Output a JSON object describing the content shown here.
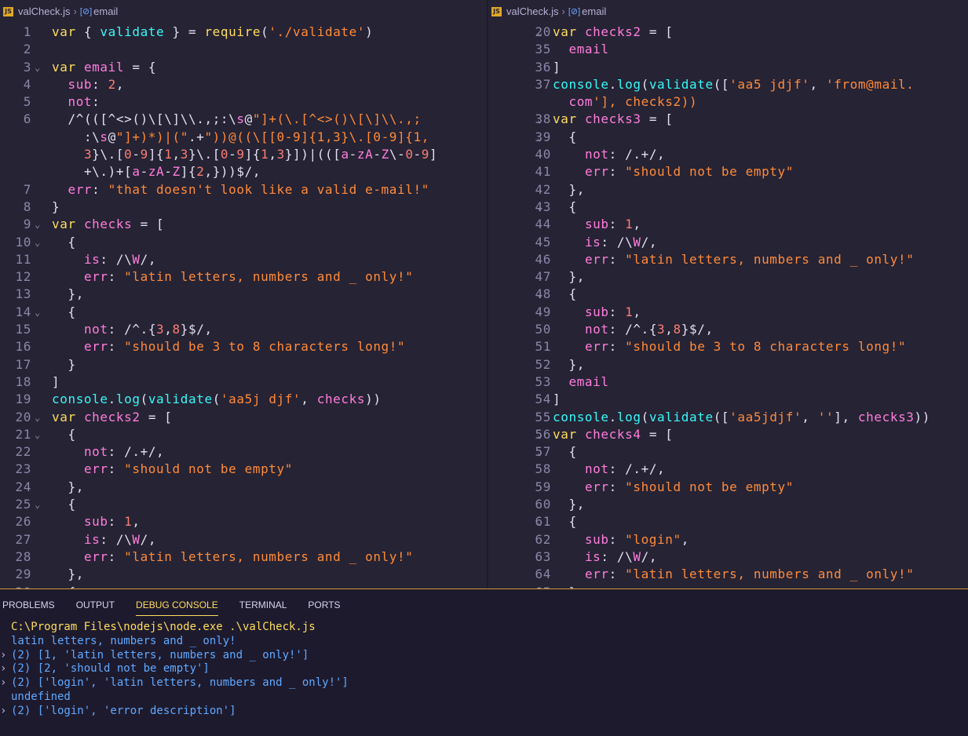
{
  "left_editor": {
    "breadcrumb": {
      "file": "valCheck.js",
      "symbol": "email"
    },
    "lines": [
      {
        "no": "1",
        "fold": "",
        "text": "var { validate } = require('./validate')"
      },
      {
        "no": "2",
        "fold": "",
        "text": ""
      },
      {
        "no": "3",
        "fold": "⌄",
        "text": "var email = {"
      },
      {
        "no": "4",
        "fold": "",
        "text": "  sub: 2,"
      },
      {
        "no": "5",
        "fold": "",
        "text": "  not:"
      },
      {
        "no": "6",
        "fold": "",
        "text": "  /^(([^<>()\\[\\]\\\\.,;:\\s@\"]+(\\.[^<>()\\[\\]\\\\.,;"
      },
      {
        "no": "",
        "fold": "",
        "text": "    :\\s@\"]+)*)|(\".+\"))@((\\[[0-9]{1,3}\\.[0-9]{1,"
      },
      {
        "no": "",
        "fold": "",
        "text": "    3}\\.[0-9]{1,3}\\.[0-9]{1,3}])|(([a-zA-Z\\-0-9]"
      },
      {
        "no": "",
        "fold": "",
        "text": "    +\\.)+[a-zA-Z]{2,}))$/,"
      },
      {
        "no": "7",
        "fold": "",
        "text": "  err: \"that doesn't look like a valid e-mail!\""
      },
      {
        "no": "8",
        "fold": "",
        "text": "}"
      },
      {
        "no": "9",
        "fold": "⌄",
        "text": "var checks = ["
      },
      {
        "no": "10",
        "fold": "⌄",
        "text": "  {"
      },
      {
        "no": "11",
        "fold": "",
        "text": "    is: /\\W/,"
      },
      {
        "no": "12",
        "fold": "",
        "text": "    err: \"latin letters, numbers and _ only!\""
      },
      {
        "no": "13",
        "fold": "",
        "text": "  },"
      },
      {
        "no": "14",
        "fold": "⌄",
        "text": "  {"
      },
      {
        "no": "15",
        "fold": "",
        "text": "    not: /^.{3,8}$/,"
      },
      {
        "no": "16",
        "fold": "",
        "text": "    err: \"should be 3 to 8 characters long!\""
      },
      {
        "no": "17",
        "fold": "",
        "text": "  }"
      },
      {
        "no": "18",
        "fold": "",
        "text": "]"
      },
      {
        "no": "19",
        "fold": "",
        "text": "console.log(validate('aa5j djf', checks))"
      },
      {
        "no": "20",
        "fold": "⌄",
        "text": "var checks2 = ["
      },
      {
        "no": "21",
        "fold": "⌄",
        "text": "  {"
      },
      {
        "no": "22",
        "fold": "",
        "text": "    not: /.+/,"
      },
      {
        "no": "23",
        "fold": "",
        "text": "    err: \"should not be empty\""
      },
      {
        "no": "24",
        "fold": "",
        "text": "  },"
      },
      {
        "no": "25",
        "fold": "⌄",
        "text": "  {"
      },
      {
        "no": "26",
        "fold": "",
        "text": "    sub: 1,"
      },
      {
        "no": "27",
        "fold": "",
        "text": "    is: /\\W/,"
      },
      {
        "no": "28",
        "fold": "",
        "text": "    err: \"latin letters, numbers and _ only!\""
      },
      {
        "no": "29",
        "fold": "",
        "text": "  },"
      },
      {
        "no": "30",
        "fold": "",
        "text": "  {"
      }
    ]
  },
  "right_editor": {
    "breadcrumb": {
      "file": "valCheck.js",
      "symbol": "email"
    },
    "lines": [
      {
        "no": "20",
        "fold": "⌄",
        "text": "var checks2 = ["
      },
      {
        "no": "35",
        "fold": "",
        "text": "  email"
      },
      {
        "no": "36",
        "fold": "",
        "text": "]"
      },
      {
        "no": "37",
        "fold": "",
        "text": "console.log(validate(['aa5 jdjf', 'from@mail."
      },
      {
        "no": "",
        "fold": "",
        "text": "  com'], checks2))"
      },
      {
        "no": "38",
        "fold": "⌄",
        "text": "var checks3 = ["
      },
      {
        "no": "39",
        "fold": "⌄",
        "text": "  {"
      },
      {
        "no": "40",
        "fold": "",
        "text": "    not: /.+/,"
      },
      {
        "no": "41",
        "fold": "",
        "text": "    err: \"should not be empty\""
      },
      {
        "no": "42",
        "fold": "",
        "text": "  },"
      },
      {
        "no": "43",
        "fold": "⌄",
        "text": "  {"
      },
      {
        "no": "44",
        "fold": "",
        "text": "    sub: 1,"
      },
      {
        "no": "45",
        "fold": "",
        "text": "    is: /\\W/,"
      },
      {
        "no": "46",
        "fold": "",
        "text": "    err: \"latin letters, numbers and _ only!\""
      },
      {
        "no": "47",
        "fold": "",
        "text": "  },"
      },
      {
        "no": "48",
        "fold": "⌄",
        "text": "  {"
      },
      {
        "no": "49",
        "fold": "",
        "text": "    sub: 1,"
      },
      {
        "no": "50",
        "fold": "",
        "text": "    not: /^.{3,8}$/,"
      },
      {
        "no": "51",
        "fold": "",
        "text": "    err: \"should be 3 to 8 characters long!\""
      },
      {
        "no": "52",
        "fold": "",
        "text": "  },"
      },
      {
        "no": "53",
        "fold": "",
        "text": "  email"
      },
      {
        "no": "54",
        "fold": "",
        "text": "]"
      },
      {
        "no": "55",
        "fold": "",
        "text": "console.log(validate(['aa5jdjf', ''], checks3))"
      },
      {
        "no": "56",
        "fold": "⌄",
        "text": "var checks4 = ["
      },
      {
        "no": "57",
        "fold": "⌄",
        "text": "  {"
      },
      {
        "no": "58",
        "fold": "",
        "text": "    not: /.+/,"
      },
      {
        "no": "59",
        "fold": "",
        "text": "    err: \"should not be empty\""
      },
      {
        "no": "60",
        "fold": "",
        "text": "  },"
      },
      {
        "no": "61",
        "fold": "⌄",
        "text": "  {"
      },
      {
        "no": "62",
        "fold": "",
        "text": "    sub: \"login\","
      },
      {
        "no": "63",
        "fold": "",
        "text": "    is: /\\W/,"
      },
      {
        "no": "64",
        "fold": "",
        "text": "    err: \"latin letters, numbers and _ only!\""
      },
      {
        "no": "65",
        "fold": "",
        "text": "  }"
      }
    ]
  },
  "panel": {
    "tabs": [
      "PROBLEMS",
      "OUTPUT",
      "DEBUG CONSOLE",
      "TERMINAL",
      "PORTS"
    ],
    "active_tab": "DEBUG CONSOLE",
    "console": [
      {
        "chevron": false,
        "color": "yellow",
        "text": "C:\\Program Files\\nodejs\\node.exe .\\valCheck.js"
      },
      {
        "chevron": false,
        "color": "blue",
        "text": "latin letters, numbers and _ only!"
      },
      {
        "chevron": true,
        "color": "blue",
        "text": "(2) [1, 'latin letters, numbers and _ only!']"
      },
      {
        "chevron": true,
        "color": "blue",
        "text": "(2) [2, 'should not be empty']"
      },
      {
        "chevron": true,
        "color": "blue",
        "text": "(2) ['login', 'latin letters, numbers and _ only!']"
      },
      {
        "chevron": false,
        "color": "blue",
        "text": "undefined"
      },
      {
        "chevron": true,
        "color": "blue",
        "text": "(2) ['login', 'error description']"
      }
    ]
  },
  "colors": {
    "background": "#262335",
    "keyword": "#fede5d",
    "variable": "#ff7edb",
    "string": "#ff8b39",
    "number": "#f97e72",
    "function": "#36f9f6",
    "console_path": "#fede5d",
    "console_output": "#5fa9ff"
  },
  "icons": {
    "file": "js-file-icon",
    "symbol": "variable-symbol-icon",
    "fold": "chevron-down-icon",
    "console_chevron": "chevron-right-icon"
  }
}
